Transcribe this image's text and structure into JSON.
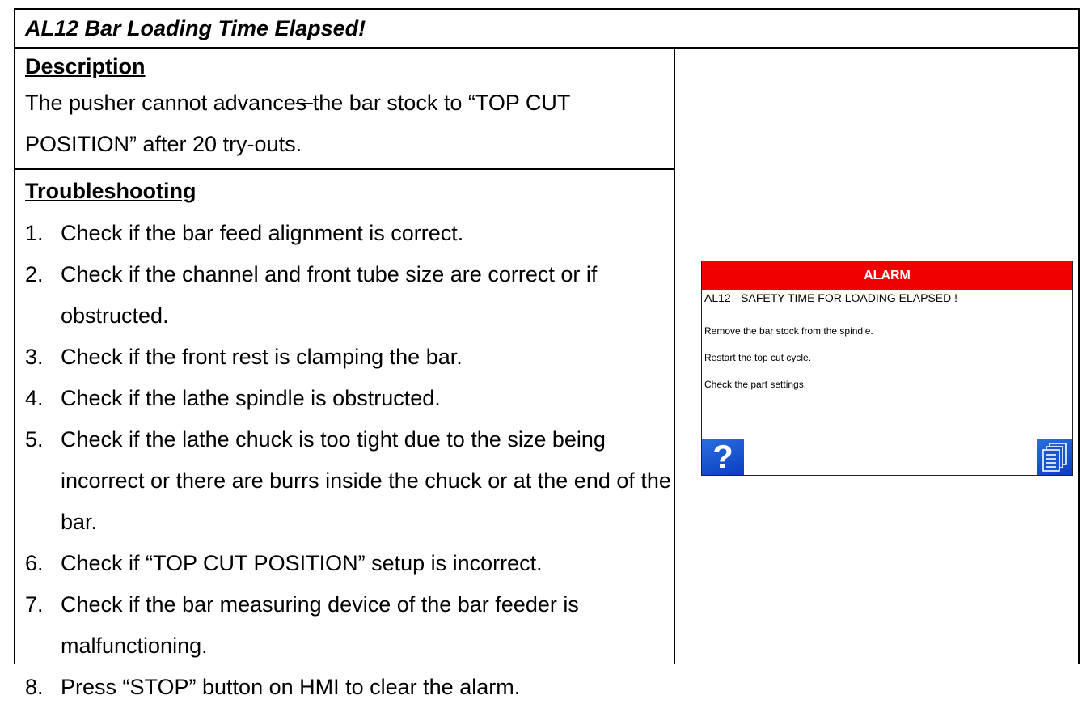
{
  "title": "AL12 Bar Loading Time Elapsed!",
  "description": {
    "heading": "Description",
    "text_before": "The pusher cannot advance",
    "text_strike": "s ",
    "text_after": "the bar stock to “TOP CUT POSITION” after 20 try-outs."
  },
  "troubleshooting": {
    "heading": "Troubleshooting",
    "items": [
      {
        "num": "1.",
        "text": "Check if the bar feed alignment is correct."
      },
      {
        "num": "2.",
        "text": "Check if the channel and front tube size are correct or if obstructed."
      },
      {
        "num": "3.",
        "text": "Check if the front rest is clamping the bar."
      },
      {
        "num": "4.",
        "text": "Check if the lathe spindle is obstructed."
      },
      {
        "num": "5.",
        "text": "Check if the lathe chuck is too tight due to the size being incorrect or there are burrs inside the chuck or at the end of the bar."
      },
      {
        "num": "6.",
        "text": "Check if “TOP CUT POSITION” setup is incorrect."
      },
      {
        "num": "7.",
        "text": "Check if the bar measuring device of the bar feeder is malfunctioning."
      },
      {
        "num": "8.",
        "text": "Press “STOP” button on HMI to clear the alarm."
      }
    ]
  },
  "hmi": {
    "header": "ALARM",
    "code_line": "AL12 - SAFETY TIME FOR LOADING ELAPSED !",
    "lines": [
      "Remove the bar stock from the spindle.",
      "Restart the top cut cycle.",
      "Check the part settings."
    ],
    "help_glyph": "?",
    "help_icon": "help-icon",
    "list_icon": "document-list-icon",
    "header_color": "#f00000",
    "button_color": "#0a3ec0"
  }
}
